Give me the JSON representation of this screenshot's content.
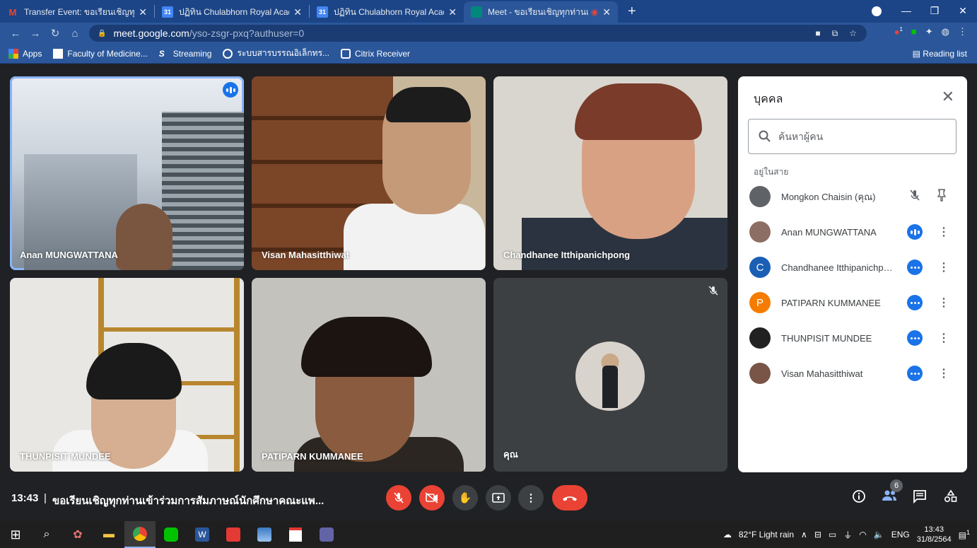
{
  "browser": {
    "tabs": [
      {
        "title": "Transfer Event: ขอเรียนเชิญทุกท่านเ",
        "icon": "gmail-icon"
      },
      {
        "title": "ปฏิทิน Chulabhorn Royal Academy",
        "icon": "calendar-icon"
      },
      {
        "title": "ปฏิทิน Chulabhorn Royal Academy",
        "icon": "calendar-icon"
      },
      {
        "title": "Meet - ขอเรียนเชิญทุกท่านเข้าร่",
        "icon": "meet-icon",
        "active": true
      }
    ],
    "url_host": "meet.google.com",
    "url_path": "/yso-zsgr-pxq?authuser=0",
    "bookmarks": [
      "Apps",
      "Faculty of Medicine...",
      "Streaming",
      "ระบบสารบรรณอิเล็กทร...",
      "Citrix Receiver"
    ],
    "reading_list": "Reading list",
    "ext_badge": "1"
  },
  "meeting": {
    "time": "13:43",
    "title": "ขอเรียนเชิญทุกท่านเข้าร่วมการสัมภาษณ์นักศึกษาคณะแพ...",
    "participant_count": "6",
    "tiles": [
      {
        "name": "Anan MUNGWATTANA",
        "speaking": true
      },
      {
        "name": "Visan Mahasitthiwat"
      },
      {
        "name": "Chandhanee Itthipanichpong"
      },
      {
        "name": "THUNPISIT MUNDEE"
      },
      {
        "name": "PATIPARN KUMMANEE"
      },
      {
        "name": "คุณ",
        "muted": true
      }
    ]
  },
  "people_panel": {
    "title": "บุคคล",
    "search_placeholder": "ค้นหาผู้คน",
    "section_label": "อยู่ในสาย",
    "people": [
      {
        "name": "Mongkon Chaisin (คุณ)",
        "avatar_color": "#5f6368",
        "initial": ""
      },
      {
        "name": "Anan MUNGWATTANA",
        "avatar_color": "#8d6e63",
        "initial": ""
      },
      {
        "name": "Chandhanee Itthipanichpo...",
        "avatar_color": "#1a5fb4",
        "initial": "C"
      },
      {
        "name": "PATIPARN KUMMANEE",
        "avatar_color": "#f57c00",
        "initial": "P"
      },
      {
        "name": "THUNPISIT MUNDEE",
        "avatar_color": "#212121",
        "initial": ""
      },
      {
        "name": "Visan Mahasitthiwat",
        "avatar_color": "#795548",
        "initial": ""
      }
    ]
  },
  "taskbar": {
    "weather": "82°F  Light rain",
    "lang": "ENG",
    "time": "13:43",
    "date": "31/8/2564",
    "notif_count": "1"
  },
  "colors": {
    "meet_red": "#ea4335",
    "meet_blue": "#1a73e8",
    "chrome_blue": "#2b579a"
  }
}
